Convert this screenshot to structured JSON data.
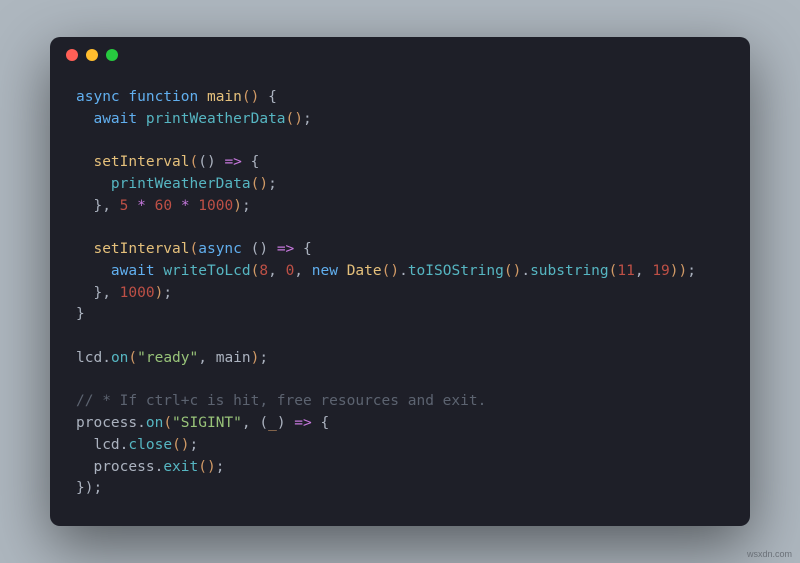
{
  "window": {
    "traffic_lights": [
      "close",
      "minimize",
      "zoom"
    ]
  },
  "code": {
    "tokens": [
      [
        {
          "t": "async",
          "c": "kw"
        },
        {
          "t": " ",
          "c": "punc"
        },
        {
          "t": "function",
          "c": "kw"
        },
        {
          "t": " ",
          "c": "punc"
        },
        {
          "t": "main",
          "c": "fn"
        },
        {
          "t": "()",
          "c": "par"
        },
        {
          "t": " {",
          "c": "punc"
        }
      ],
      [
        {
          "t": "  ",
          "c": "punc"
        },
        {
          "t": "await",
          "c": "kw"
        },
        {
          "t": " ",
          "c": "punc"
        },
        {
          "t": "printWeatherData",
          "c": "call"
        },
        {
          "t": "()",
          "c": "par"
        },
        {
          "t": ";",
          "c": "punc"
        }
      ],
      [],
      [
        {
          "t": "  ",
          "c": "punc"
        },
        {
          "t": "setInterval",
          "c": "fn"
        },
        {
          "t": "(",
          "c": "par"
        },
        {
          "t": "()",
          "c": "punc"
        },
        {
          "t": " ",
          "c": "punc"
        },
        {
          "t": "=>",
          "c": "op"
        },
        {
          "t": " {",
          "c": "punc"
        }
      ],
      [
        {
          "t": "    ",
          "c": "punc"
        },
        {
          "t": "printWeatherData",
          "c": "call"
        },
        {
          "t": "()",
          "c": "par"
        },
        {
          "t": ";",
          "c": "punc"
        }
      ],
      [
        {
          "t": "  }",
          "c": "punc"
        },
        {
          "t": ", ",
          "c": "punc"
        },
        {
          "t": "5",
          "c": "num"
        },
        {
          "t": " ",
          "c": "punc"
        },
        {
          "t": "*",
          "c": "op"
        },
        {
          "t": " ",
          "c": "punc"
        },
        {
          "t": "60",
          "c": "num"
        },
        {
          "t": " ",
          "c": "punc"
        },
        {
          "t": "*",
          "c": "op"
        },
        {
          "t": " ",
          "c": "punc"
        },
        {
          "t": "1000",
          "c": "num"
        },
        {
          "t": ")",
          "c": "par"
        },
        {
          "t": ";",
          "c": "punc"
        }
      ],
      [],
      [
        {
          "t": "  ",
          "c": "punc"
        },
        {
          "t": "setInterval",
          "c": "fn"
        },
        {
          "t": "(",
          "c": "par"
        },
        {
          "t": "async",
          "c": "kw"
        },
        {
          "t": " ",
          "c": "punc"
        },
        {
          "t": "()",
          "c": "punc"
        },
        {
          "t": " ",
          "c": "punc"
        },
        {
          "t": "=>",
          "c": "op"
        },
        {
          "t": " {",
          "c": "punc"
        }
      ],
      [
        {
          "t": "    ",
          "c": "punc"
        },
        {
          "t": "await",
          "c": "kw"
        },
        {
          "t": " ",
          "c": "punc"
        },
        {
          "t": "writeToLcd",
          "c": "call"
        },
        {
          "t": "(",
          "c": "par"
        },
        {
          "t": "8",
          "c": "num"
        },
        {
          "t": ", ",
          "c": "punc"
        },
        {
          "t": "0",
          "c": "num"
        },
        {
          "t": ", ",
          "c": "punc"
        },
        {
          "t": "new",
          "c": "kw"
        },
        {
          "t": " ",
          "c": "punc"
        },
        {
          "t": "Date",
          "c": "fn"
        },
        {
          "t": "()",
          "c": "par"
        },
        {
          "t": ".",
          "c": "punc"
        },
        {
          "t": "toISOString",
          "c": "call"
        },
        {
          "t": "()",
          "c": "par"
        },
        {
          "t": ".",
          "c": "punc"
        },
        {
          "t": "substring",
          "c": "call"
        },
        {
          "t": "(",
          "c": "par"
        },
        {
          "t": "11",
          "c": "num"
        },
        {
          "t": ", ",
          "c": "punc"
        },
        {
          "t": "19",
          "c": "num"
        },
        {
          "t": "))",
          "c": "par"
        },
        {
          "t": ";",
          "c": "punc"
        }
      ],
      [
        {
          "t": "  }",
          "c": "punc"
        },
        {
          "t": ", ",
          "c": "punc"
        },
        {
          "t": "1000",
          "c": "num"
        },
        {
          "t": ")",
          "c": "par"
        },
        {
          "t": ";",
          "c": "punc"
        }
      ],
      [
        {
          "t": "}",
          "c": "punc"
        }
      ],
      [],
      [
        {
          "t": "lcd",
          "c": "obj"
        },
        {
          "t": ".",
          "c": "punc"
        },
        {
          "t": "on",
          "c": "call"
        },
        {
          "t": "(",
          "c": "par"
        },
        {
          "t": "\"ready\"",
          "c": "str"
        },
        {
          "t": ", ",
          "c": "punc"
        },
        {
          "t": "main",
          "c": "obj"
        },
        {
          "t": ")",
          "c": "par"
        },
        {
          "t": ";",
          "c": "punc"
        }
      ],
      [],
      [
        {
          "t": "// * If ctrl+c is hit, free resources and exit.",
          "c": "cmt"
        }
      ],
      [
        {
          "t": "process",
          "c": "obj"
        },
        {
          "t": ".",
          "c": "punc"
        },
        {
          "t": "on",
          "c": "call"
        },
        {
          "t": "(",
          "c": "par"
        },
        {
          "t": "\"SIGINT\"",
          "c": "str"
        },
        {
          "t": ", ",
          "c": "punc"
        },
        {
          "t": "(",
          "c": "punc"
        },
        {
          "t": "_",
          "c": "parm"
        },
        {
          "t": ")",
          "c": "punc"
        },
        {
          "t": " ",
          "c": "punc"
        },
        {
          "t": "=>",
          "c": "op"
        },
        {
          "t": " {",
          "c": "punc"
        }
      ],
      [
        {
          "t": "  ",
          "c": "punc"
        },
        {
          "t": "lcd",
          "c": "obj"
        },
        {
          "t": ".",
          "c": "punc"
        },
        {
          "t": "close",
          "c": "call"
        },
        {
          "t": "()",
          "c": "par"
        },
        {
          "t": ";",
          "c": "punc"
        }
      ],
      [
        {
          "t": "  ",
          "c": "punc"
        },
        {
          "t": "process",
          "c": "obj"
        },
        {
          "t": ".",
          "c": "punc"
        },
        {
          "t": "exit",
          "c": "call"
        },
        {
          "t": "()",
          "c": "par"
        },
        {
          "t": ";",
          "c": "punc"
        }
      ],
      [
        {
          "t": "})",
          "c": "punc"
        },
        {
          "t": ";",
          "c": "punc"
        }
      ]
    ]
  },
  "watermark": "wsxdn.com"
}
